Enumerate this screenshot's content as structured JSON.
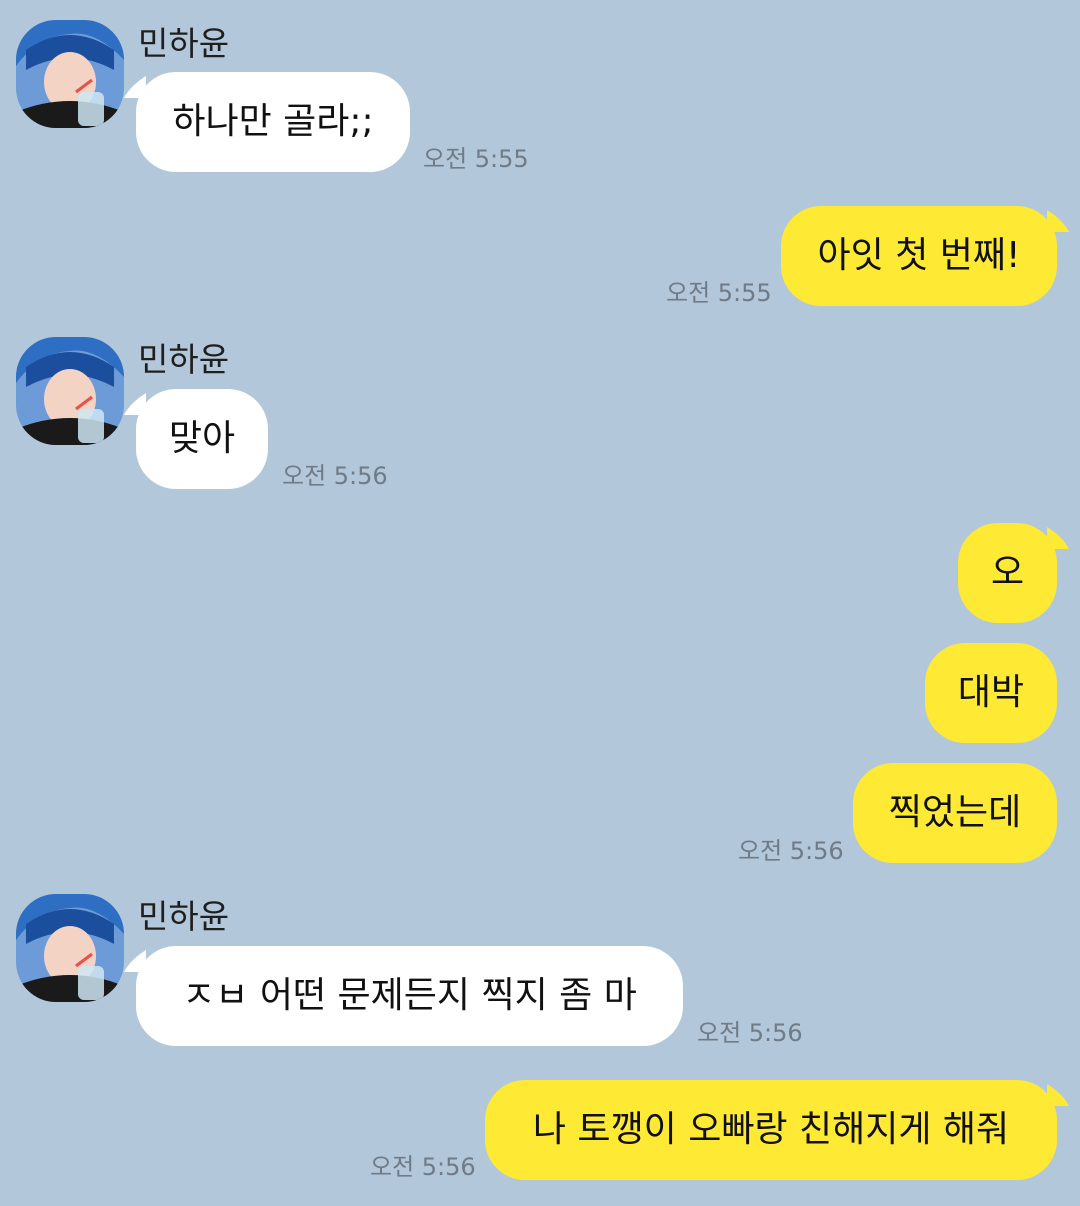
{
  "sender_name": "민하윤",
  "messages": [
    {
      "text": "하나만 골라;;",
      "time": "오전 5:55"
    },
    {
      "text": "아잇 첫 번째!",
      "time": "오전 5:55"
    },
    {
      "text": "맞아",
      "time": "오전 5:56"
    },
    {
      "text": "오"
    },
    {
      "text": "대박"
    },
    {
      "text": "찍었는데",
      "time": "오전 5:56"
    },
    {
      "text": "ㅈㅂ 어떤 문제든지 찍지 좀 마",
      "time": "오전 5:56"
    },
    {
      "text": "나 토깽이 오빠랑 친해지게 해줘",
      "time": "오전 5:56"
    }
  ],
  "colors": {
    "background": "#b3c7da",
    "incoming_bubble": "#ffffff",
    "outgoing_bubble": "#fee934",
    "timestamp": "#6f7b87"
  },
  "icons": {
    "avatar": "profile-photo-avatar"
  }
}
